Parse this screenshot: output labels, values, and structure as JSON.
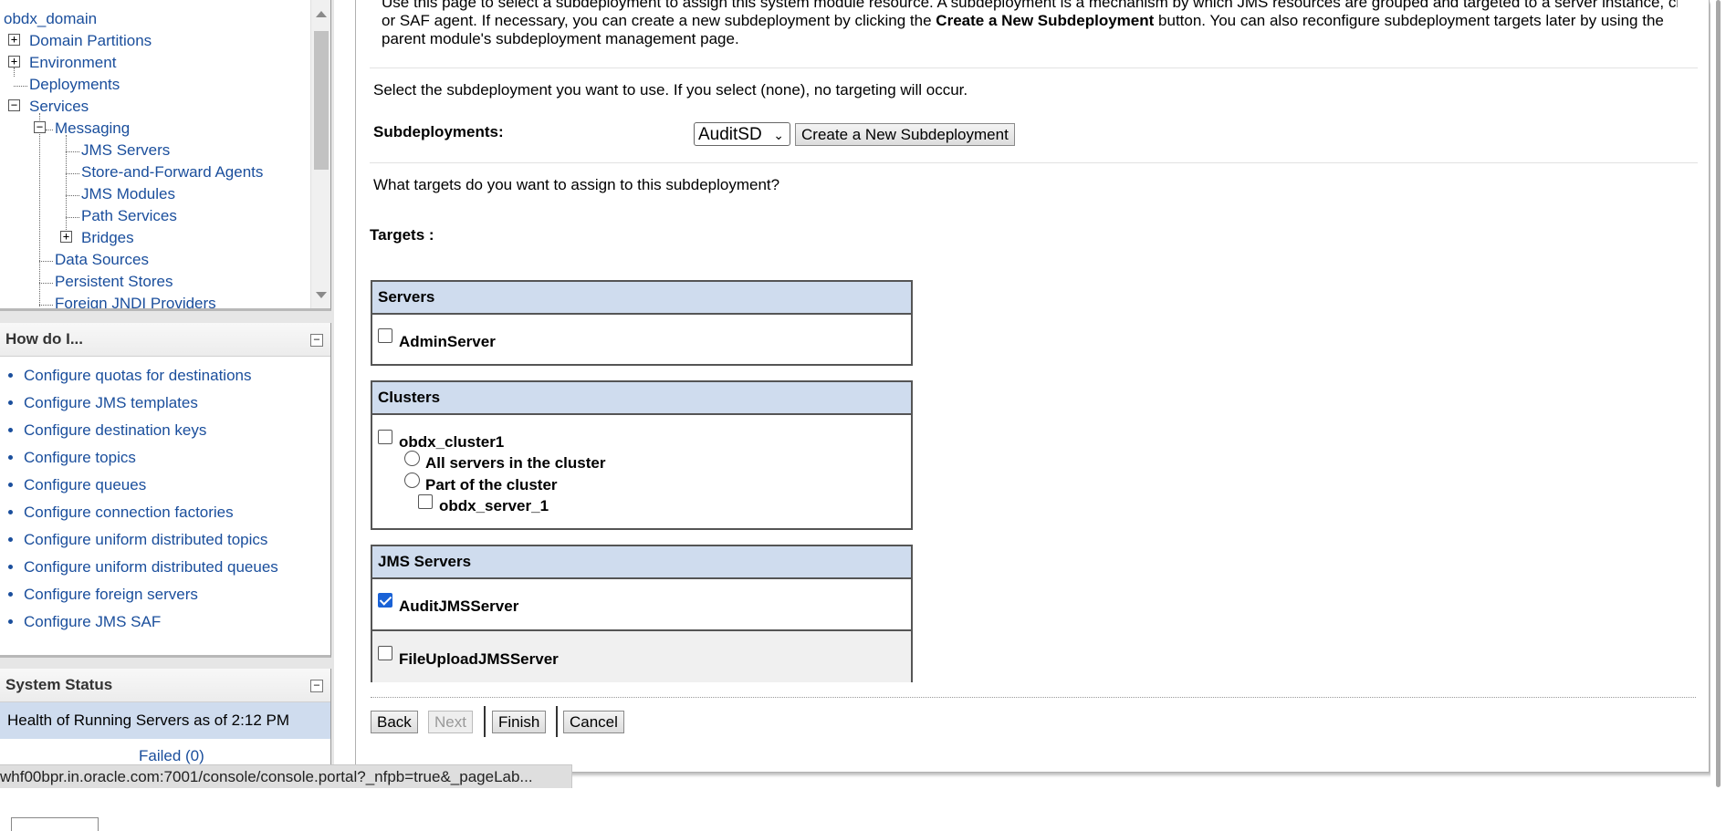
{
  "tree": {
    "items": [
      {
        "label": "obdx_domain"
      },
      {
        "label": "Domain Partitions"
      },
      {
        "label": "Environment"
      },
      {
        "label": "Deployments"
      },
      {
        "label": "Services"
      },
      {
        "label": "Messaging"
      },
      {
        "label": "JMS Servers"
      },
      {
        "label": "Store-and-Forward Agents"
      },
      {
        "label": "JMS Modules"
      },
      {
        "label": "Path Services"
      },
      {
        "label": "Bridges"
      },
      {
        "label": "Data Sources"
      },
      {
        "label": "Persistent Stores"
      },
      {
        "label": "Foreign JNDI Providers"
      }
    ]
  },
  "howdo": {
    "title": "How do I...",
    "items": [
      "Configure quotas for destinations",
      "Configure JMS templates",
      "Configure destination keys",
      "Configure topics",
      "Configure queues",
      "Configure connection factories",
      "Configure uniform distributed topics",
      "Configure uniform distributed queues",
      "Configure foreign servers",
      "Configure JMS SAF"
    ]
  },
  "system_status": {
    "title": "System Status",
    "health_label": "Health of Running Servers as of  2:12 PM",
    "failed_label": "Failed (0)"
  },
  "main": {
    "intro_line1": "Use this page to select a subdeployment to assign this system module resource. A subdeployment is a mechanism by which JMS resources are grouped and targeted to a server instance, cluster,",
    "intro_line2_a": "or SAF agent. If necessary, you can create a new subdeployment by clicking the ",
    "intro_line2_b": "Create a New Subdeployment",
    "intro_line2_c": " button. You can also reconfigure subdeployment targets later by using the",
    "intro_line3": "parent module's subdeployment management page.",
    "select_text": "Select the subdeployment you want to use. If you select (none), no targeting will occur.",
    "subdeployments_label": "Subdeployments:",
    "subdeployment_value": "AuditSD",
    "create_button": "Create a New Subdeployment",
    "targets_question": "What targets do you want to assign to this subdeployment?",
    "targets_label": "Targets :"
  },
  "servers": {
    "header": "Servers",
    "items": [
      {
        "label": "AdminServer",
        "checked": false
      }
    ]
  },
  "clusters": {
    "header": "Clusters",
    "cluster_name": "obdx_cluster1",
    "option_all": "All servers in the cluster",
    "option_part": "Part of the cluster",
    "member": "obdx_server_1"
  },
  "jms_servers": {
    "header": "JMS Servers",
    "items": [
      {
        "label": "AuditJMSServer",
        "checked": true
      },
      {
        "label": "FileUploadJMSServer",
        "checked": false
      }
    ]
  },
  "buttons": {
    "back": "Back",
    "next": "Next",
    "finish": "Finish",
    "cancel": "Cancel"
  },
  "statusbar": {
    "url": "whf00bpr.in.oracle.com:7001/console/console.portal?_nfpb=true&_pageLab..."
  }
}
